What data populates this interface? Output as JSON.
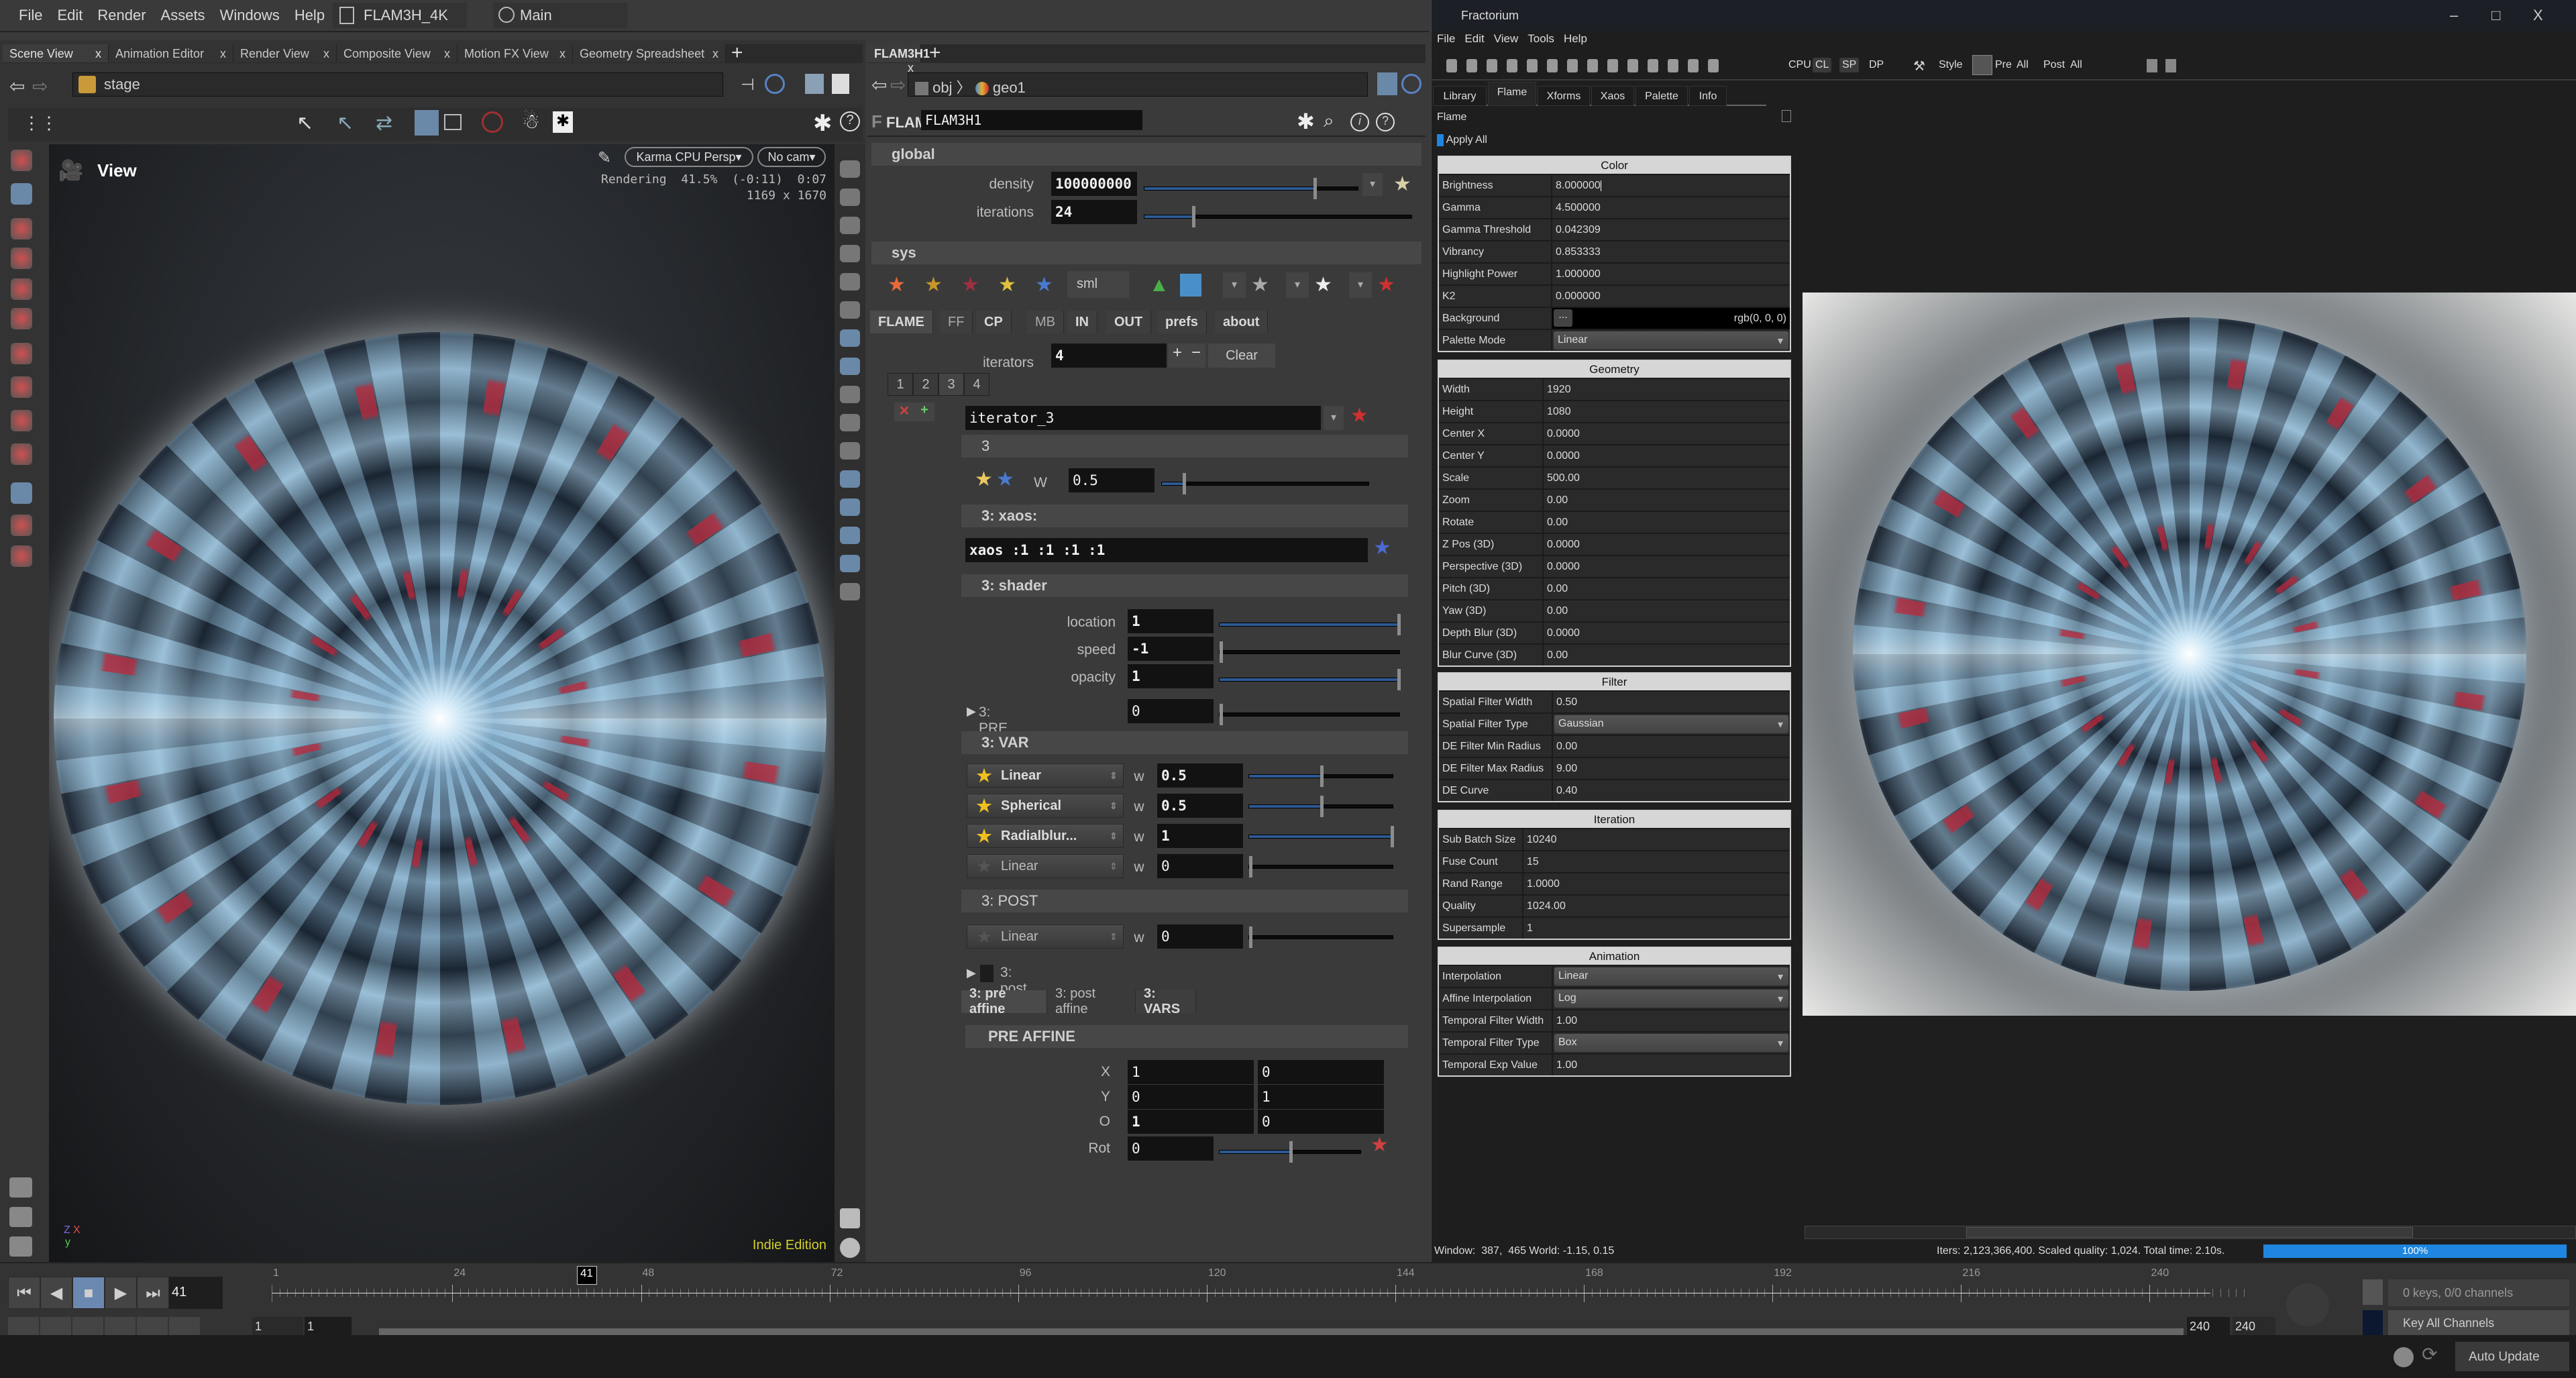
{
  "houdini": {
    "menu": [
      "File",
      "Edit",
      "Render",
      "Assets",
      "Windows",
      "Help"
    ],
    "desktop": "FLAM3H_4K",
    "context": "Main",
    "pane_tabs": [
      "Scene View",
      "Animation Editor",
      "Render View",
      "Composite View",
      "Motion FX View",
      "Geometry Spreadsheet"
    ],
    "close_glyph": "x",
    "add_glyph": "+",
    "scene_path": "stage",
    "viewport": {
      "title": "View",
      "renderer": "Karma CPU  Persp",
      "camera": "No cam",
      "status": "Rendering  41.5%  (-0:11)  0:07",
      "resolution": "1169 x 1670",
      "edition": "Indie Edition",
      "axes": {
        "z": "Z",
        "x": "X",
        "y": "y"
      }
    },
    "params": {
      "tab": "FLAM3H1",
      "path": [
        "obj",
        "geo1"
      ],
      "node_type": "FLAM3H",
      "node_name": "FLAM3H1",
      "global": {
        "header": "global",
        "density_label": "density",
        "density": "100000000",
        "density_fraction": 0.8,
        "iterations_label": "iterations",
        "iterations": "24",
        "iterations_fraction": 0.18
      },
      "sys": {
        "header": "sys",
        "preset_size": "sml"
      },
      "tabs": [
        "FLAME",
        "FF",
        "CP",
        "MB",
        "IN",
        "OUT",
        "prefs",
        "about"
      ],
      "iterators_label": "iterators",
      "iterators": "4",
      "plus": "+",
      "minus": "−",
      "clear": "Clear",
      "iterator_tabs": [
        "1",
        "2",
        "3",
        "4"
      ],
      "iterator_name": "iterator_3",
      "iter_header": "3",
      "weight_label": "W",
      "weight": "0.5",
      "weight_fraction": 0.1,
      "xaos_header": "3: xaos:",
      "xaos": "xaos :1 :1 :1 :1",
      "shader_header": "3: shader",
      "shader": [
        {
          "label": "location",
          "value": "1",
          "fraction": 1
        },
        {
          "label": "speed",
          "value": "-1",
          "fraction": 0
        },
        {
          "label": "opacity",
          "value": "1",
          "fraction": 1
        }
      ],
      "pre": {
        "label": "3: PRE",
        "value": "0",
        "fraction": 0
      },
      "var_header": "3: VAR",
      "vars": [
        {
          "name": "Linear",
          "w": "0.5",
          "fraction": 0.5,
          "active": true
        },
        {
          "name": "Spherical",
          "w": "0.5",
          "fraction": 0.5,
          "active": true
        },
        {
          "name": "Radialblur...",
          "w": "1",
          "fraction": 1,
          "active": true
        },
        {
          "name": "Linear",
          "w": "0",
          "fraction": 0,
          "active": false
        }
      ],
      "w_label": "w",
      "post_header": "3: POST",
      "post_var": {
        "name": "Linear",
        "w": "0",
        "fraction": 0
      },
      "post_affine_toggle": "3: post affine",
      "affine_tabs": [
        "3: pre affine",
        "3: post affine",
        "3: VARS"
      ],
      "pre_affine_header": "PRE AFFINE",
      "affine": [
        {
          "label": "X",
          "a": "1",
          "b": "0"
        },
        {
          "label": "Y",
          "a": "0",
          "b": "1"
        },
        {
          "label": "O",
          "a": "1",
          "b": "0"
        }
      ],
      "rot_label": "Rot",
      "rot": "0",
      "rot_fraction": 0.5
    },
    "timeline": {
      "current_frame": "41",
      "ticks": [
        "1",
        "24",
        "48",
        "72",
        "96",
        "120",
        "144",
        "168",
        "192",
        "216",
        "240"
      ],
      "range_start": "1",
      "range_start2": "1",
      "range_end": "240",
      "range_end2": "240",
      "keys_info": "0 keys, 0/0 channels",
      "key_all": "Key All Channels",
      "auto_update": "Auto Update"
    }
  },
  "fractorium": {
    "title": "Fractorium",
    "window_buttons": [
      "–",
      "□",
      "X"
    ],
    "menu": [
      "File",
      "Edit",
      "View",
      "Tools",
      "Help"
    ],
    "toolbar_text": [
      "CPU",
      "CL",
      "SP",
      "DP",
      "Style",
      "Pre",
      "All",
      "Post",
      "All"
    ],
    "tabs": [
      "Library",
      "Flame",
      "Xforms",
      "Xaos",
      "Palette",
      "Info"
    ],
    "active_tab": "Flame",
    "dock_title": "Flame",
    "apply_all": "Apply All",
    "sections": [
      {
        "title": "Color",
        "rows": [
          [
            "Brightness",
            "8.000000"
          ],
          [
            "Gamma",
            "4.500000"
          ],
          [
            "Gamma Threshold",
            "0.042309"
          ],
          [
            "Vibrancy",
            "0.853333"
          ],
          [
            "Highlight Power",
            "1.000000"
          ],
          [
            "K2",
            "0.000000"
          ],
          [
            "Background",
            "rgb(0, 0, 0)"
          ],
          [
            "Palette Mode",
            "Linear"
          ]
        ]
      },
      {
        "title": "Geometry",
        "rows": [
          [
            "Width",
            "1920"
          ],
          [
            "Height",
            "1080"
          ],
          [
            "Center X",
            "0.0000"
          ],
          [
            "Center Y",
            "0.0000"
          ],
          [
            "Scale",
            "500.00"
          ],
          [
            "Zoom",
            "0.00"
          ],
          [
            "Rotate",
            "0.00"
          ],
          [
            "Z Pos (3D)",
            "0.0000"
          ],
          [
            "Perspective (3D)",
            "0.0000"
          ],
          [
            "Pitch (3D)",
            "0.00"
          ],
          [
            "Yaw (3D)",
            "0.00"
          ],
          [
            "Depth Blur (3D)",
            "0.0000"
          ],
          [
            "Blur Curve (3D)",
            "0.00"
          ]
        ]
      },
      {
        "title": "Filter",
        "rows": [
          [
            "Spatial Filter Width",
            "0.50"
          ],
          [
            "Spatial Filter Type",
            "Gaussian"
          ],
          [
            "DE Filter Min Radius",
            "0.00"
          ],
          [
            "DE Filter Max Radius",
            "9.00"
          ],
          [
            "DE Curve",
            "0.40"
          ]
        ]
      },
      {
        "title": "Iteration",
        "rows": [
          [
            "Sub Batch Size",
            "10240"
          ],
          [
            "Fuse Count",
            "15"
          ],
          [
            "Rand Range",
            "1.0000"
          ],
          [
            "Quality",
            "1024.00"
          ],
          [
            "Supersample",
            "1"
          ]
        ]
      },
      {
        "title": "Animation",
        "rows": [
          [
            "Interpolation",
            "Linear"
          ],
          [
            "Affine Interpolation",
            "Log"
          ],
          [
            "Temporal Filter Width",
            "1.00"
          ],
          [
            "Temporal Filter Type",
            "Box"
          ],
          [
            "Temporal Exp Value",
            "1.00"
          ]
        ]
      }
    ],
    "combo_keys": [
      "Palette Mode",
      "Spatial Filter Type",
      "Interpolation",
      "Affine Interpolation",
      "Temporal Filter Type"
    ],
    "background_button": "...",
    "status_left": "Window:  387,  465 World: -1.15, 0.15",
    "status_right": "Iters: 2,123,366,400. Scaled quality: 1,024. Total time: 2.10s.",
    "progress": "100%",
    "progress_fraction": 1
  },
  "colors": {
    "accent": "#1e86e0",
    "slider": "#2c5a94",
    "edition": "#d4d02a"
  }
}
